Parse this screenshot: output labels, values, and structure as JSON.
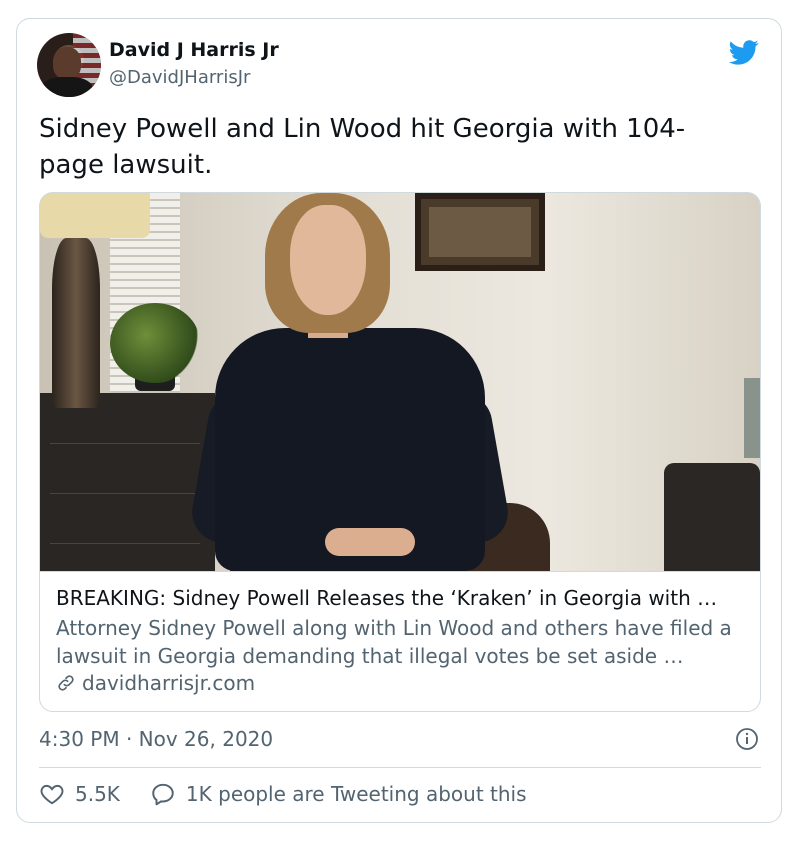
{
  "author": {
    "name": "David J Harris Jr",
    "handle": "@DavidJHarrisJr"
  },
  "tweet": {
    "text": "Sidney Powell and Lin Wood hit Georgia with 104-page lawsuit.",
    "timestamp": "4:30 PM · Nov 26, 2020"
  },
  "link_card": {
    "title": "BREAKING: Sidney Powell Releases the ‘Kraken’ in Georgia with …",
    "description": "Attorney Sidney Powell along with Lin Wood and others have filed a lawsuit in Georgia demanding that illegal votes be set aside …",
    "domain": "davidharrisjr.com"
  },
  "actions": {
    "likes": "5.5K",
    "tweeting": "1K people are Tweeting about this"
  },
  "icons": {
    "brand": "twitter-bird-icon",
    "link": "link-icon",
    "info": "info-icon",
    "like": "heart-icon",
    "reply": "speech-bubble-icon"
  },
  "colors": {
    "brand": "#1d9bf0",
    "text_primary": "#0f1419",
    "text_secondary": "#536471",
    "border": "#cfd9de"
  }
}
